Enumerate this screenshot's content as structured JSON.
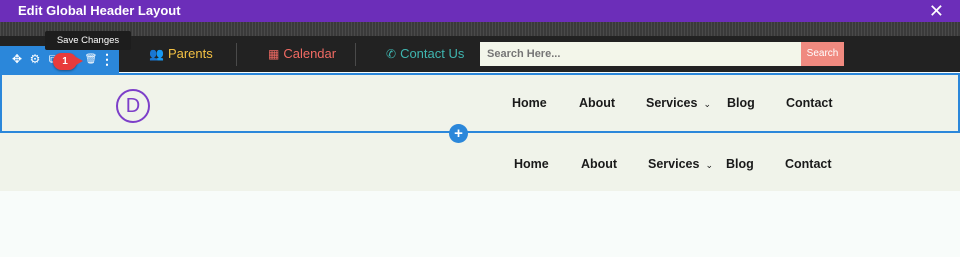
{
  "titlebar": {
    "title": "Edit Global Header Layout",
    "close_symbol": "✕"
  },
  "topbar": {
    "links": [
      {
        "label": "Parents",
        "icon": "users-icon",
        "glyph": "👥",
        "color": "#f3c043"
      },
      {
        "label": "Calendar",
        "icon": "calendar-icon",
        "glyph": "▦",
        "color": "#f06a63"
      },
      {
        "label": "Contact Us",
        "icon": "phone-icon",
        "glyph": "✆",
        "color": "#3fb6b0"
      }
    ],
    "search": {
      "placeholder": "Search Here...",
      "button_label": "Search"
    }
  },
  "module_toolbar": {
    "tooltip": "Save Changes",
    "badge": "1",
    "icons": [
      {
        "name": "move-icon",
        "glyph": "✥"
      },
      {
        "name": "gear-icon",
        "glyph": "⚙"
      },
      {
        "name": "duplicate-icon",
        "glyph": "⧉"
      },
      {
        "name": "trash-icon",
        "glyph": "🗑"
      },
      {
        "name": "more-icon",
        "glyph": "⋮"
      }
    ]
  },
  "header_primary": {
    "logo_letter": "D",
    "nav": [
      "Home",
      "About",
      "Services",
      "Blog",
      "Contact"
    ],
    "dropdown_symbol": "⌄"
  },
  "add_button": "+",
  "header_secondary": {
    "nav": [
      "Home",
      "About",
      "Services",
      "Blog",
      "Contact"
    ],
    "dropdown_symbol": "⌄"
  },
  "colors": {
    "title_bar": "#6c2eb9",
    "accent_blue": "#2b87da",
    "logo_purple": "#7d3fc9",
    "search_button": "#f08a80",
    "topbar_bg": "#222222"
  }
}
